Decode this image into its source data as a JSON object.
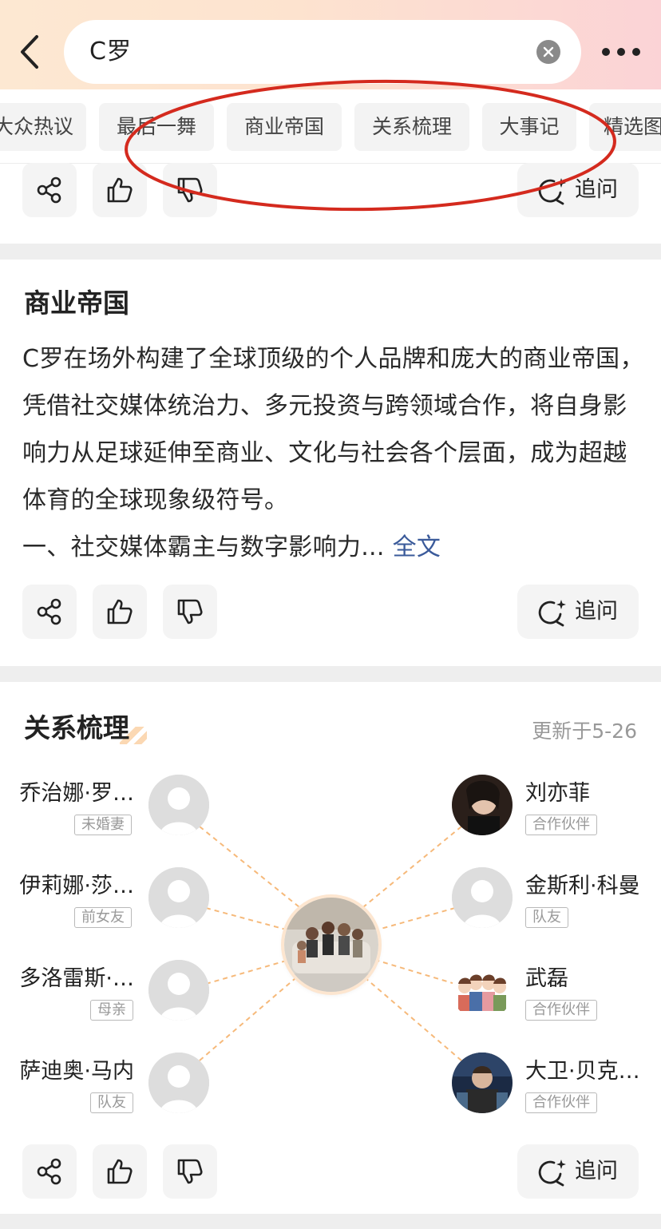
{
  "search": {
    "query": "C罗"
  },
  "tabs": [
    "大众热议",
    "最后一舞",
    "商业帝国",
    "关系梳理",
    "大事记",
    "精选图"
  ],
  "actions": {
    "ask_label": "追问"
  },
  "business": {
    "title": "商业帝国",
    "body": "C罗在场外构建了全球顶级的个人品牌和庞大的商业帝国，凭借社交媒体统治力、多元投资与跨领域合作，将自身影响力从足球延伸至商业、文化与社会各个层面，成为超越体育的全球现象级符号。",
    "body_line2": "一、社交媒体霸主与数字影响力...",
    "read_more": "全文"
  },
  "relations": {
    "title": "关系梳理",
    "updated": "更新于5-26",
    "left": [
      {
        "name": "乔治娜·罗…",
        "tag": "未婚妻"
      },
      {
        "name": "伊莉娜·莎…",
        "tag": "前女友"
      },
      {
        "name": "多洛雷斯·…",
        "tag": "母亲"
      },
      {
        "name": "萨迪奥·马内",
        "tag": "队友"
      }
    ],
    "right": [
      {
        "name": "刘亦菲",
        "tag": "合作伙伴"
      },
      {
        "name": "金斯利·科曼",
        "tag": "队友"
      },
      {
        "name": "武磊",
        "tag": "合作伙伴"
      },
      {
        "name": "大卫·贝克…",
        "tag": "合作伙伴"
      }
    ]
  },
  "colors": {
    "annotation": "#d42a1e",
    "link": "#3a5a9a",
    "connector": "#f6b97a"
  }
}
